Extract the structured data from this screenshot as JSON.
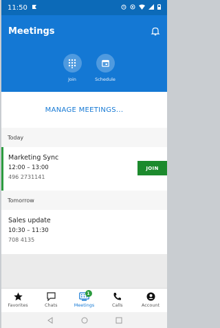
{
  "statusbar": {
    "time": "11:50"
  },
  "header": {
    "title": "Meetings",
    "actions": [
      {
        "label": "Join"
      },
      {
        "label": "Schedule"
      }
    ]
  },
  "manage": {
    "label": "MANAGE MEETINGS..."
  },
  "sections": [
    {
      "label": "Today",
      "meeting": {
        "name": "Marketing Sync",
        "time": "12:00 – 13:00",
        "number": "496 2731141",
        "join_label": "JOIN"
      }
    },
    {
      "label": "Tomorrow",
      "meeting": {
        "name": "Sales update",
        "time": "10:30 – 11:30",
        "number": "708 4135"
      }
    }
  ],
  "nav": {
    "items": [
      {
        "label": "Favorites",
        "icon": "star-icon"
      },
      {
        "label": "Chats",
        "icon": "chat-icon"
      },
      {
        "label": "Meetings",
        "icon": "dialpad-icon",
        "badge": "1",
        "active": true
      },
      {
        "label": "Calls",
        "icon": "phone-icon"
      },
      {
        "label": "Account",
        "icon": "account-icon"
      }
    ]
  },
  "colors": {
    "brand": "#1478d4",
    "join": "#1c8a2d",
    "accent": "#2c9b3f"
  }
}
